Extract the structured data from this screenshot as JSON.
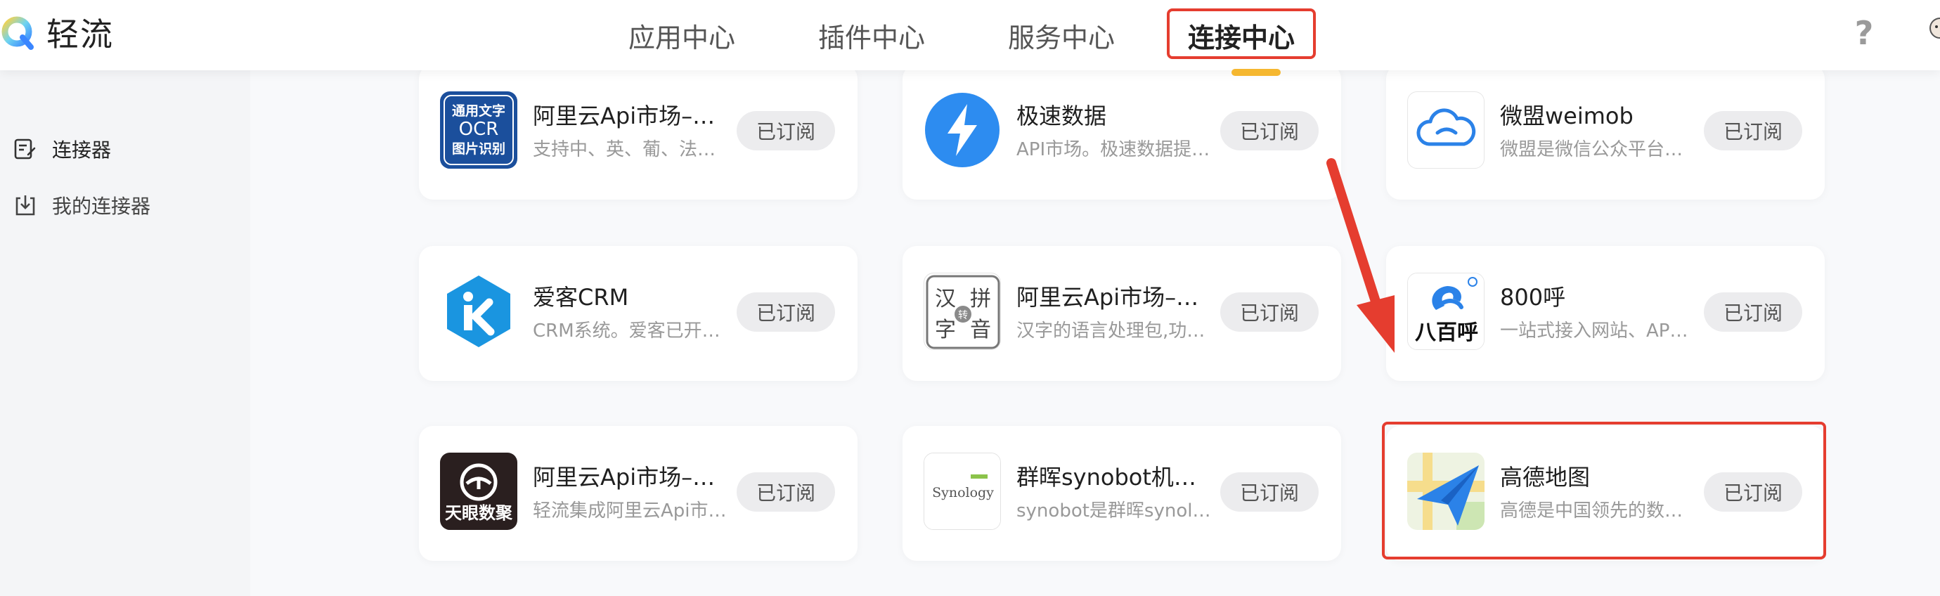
{
  "app": {
    "name": "轻流"
  },
  "nav": {
    "items": [
      "应用中心",
      "插件中心",
      "服务中心",
      "连接中心"
    ],
    "active": "连接中心",
    "help_glyph": "?"
  },
  "sidebar": {
    "items": [
      {
        "label": "连接器",
        "icon": "connector-icon"
      },
      {
        "label": "我的连接器",
        "icon": "download-box-icon"
      }
    ]
  },
  "cards": [
    {
      "title": "阿里云Api市场–通用文字识别",
      "desc": "支持中、英、葡、法、德等多语种",
      "button": "已订阅",
      "icon": "ocr-icon",
      "icon_text": [
        "通用文字",
        "OCR",
        "图片识别"
      ]
    },
    {
      "title": "极速数据",
      "desc": "API市场。极速数据提供多种数据服务",
      "button": "已订阅",
      "icon": "lightning-icon"
    },
    {
      "title": "微盟weimob",
      "desc": "微盟是微信公众平台第三方服务",
      "button": "已订阅",
      "icon": "cloud-icon"
    },
    {
      "title": "爱客CRM",
      "desc": "CRM系统。爱客已开放接口",
      "button": "已订阅",
      "icon": "ik-icon"
    },
    {
      "title": "阿里云Api市场–汉字转拼音",
      "desc": "汉字的语言处理包,功能丰富",
      "button": "已订阅",
      "icon": "hanzi-pinyin-icon",
      "icon_text": [
        "汉",
        "拼",
        "字",
        "音",
        "转"
      ]
    },
    {
      "title": "800呼",
      "desc": "一站式接入网站、APP等渠道",
      "button": "已订阅",
      "icon": "800hu-icon",
      "icon_text": [
        "八百呼"
      ]
    },
    {
      "title": "阿里云Api市场–天眼数聚",
      "desc": "轻流集成阿里云Api市场服务",
      "button": "已订阅",
      "icon": "eye-icon",
      "icon_text": [
        "天眼数聚"
      ]
    },
    {
      "title": "群晖synobot机器人",
      "desc": "synobot是群晖synology机器人",
      "button": "已订阅",
      "icon": "synology-icon",
      "icon_text": [
        "Synology"
      ]
    },
    {
      "title": "高德地图",
      "desc": "高德是中国领先的数字地图提供商",
      "button": "已订阅",
      "icon": "amap-icon"
    }
  ],
  "colors": {
    "highlight": "#e53d2f",
    "accent_underline": "#f5b730",
    "button_bg": "#ececee"
  }
}
